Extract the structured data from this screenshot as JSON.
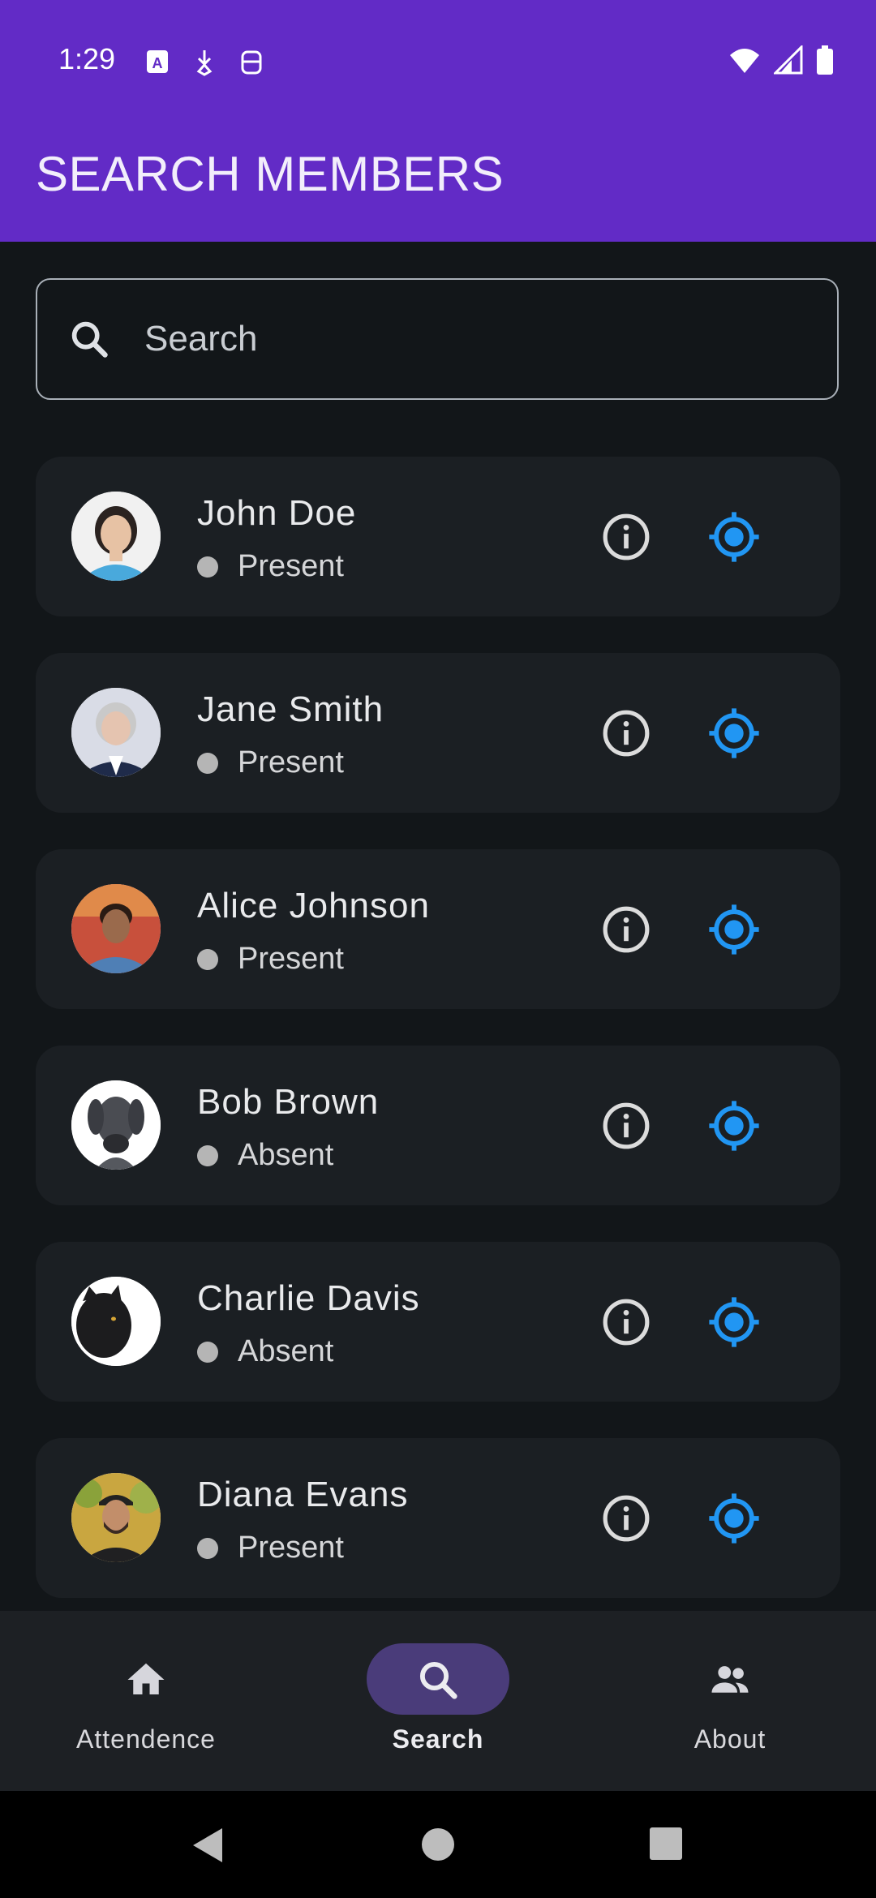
{
  "status_bar": {
    "time": "1:29"
  },
  "app_bar": {
    "title": "SEARCH MEMBERS"
  },
  "search": {
    "placeholder": "Search",
    "value": ""
  },
  "members": [
    {
      "name": "John Doe",
      "status": "Present"
    },
    {
      "name": "Jane Smith",
      "status": "Present"
    },
    {
      "name": "Alice Johnson",
      "status": "Present"
    },
    {
      "name": "Bob Brown",
      "status": "Absent"
    },
    {
      "name": "Charlie Davis",
      "status": "Absent"
    },
    {
      "name": "Diana Evans",
      "status": "Present"
    }
  ],
  "bottom_nav": [
    {
      "label": "Attendence",
      "icon": "home-icon"
    },
    {
      "label": "Search",
      "icon": "search-icon",
      "active": true
    },
    {
      "label": "About",
      "icon": "people-icon"
    }
  ],
  "colors": {
    "app_bar": "#622bc6",
    "accent": "#2196f3",
    "background": "#121619",
    "card": "#1b1f23"
  }
}
